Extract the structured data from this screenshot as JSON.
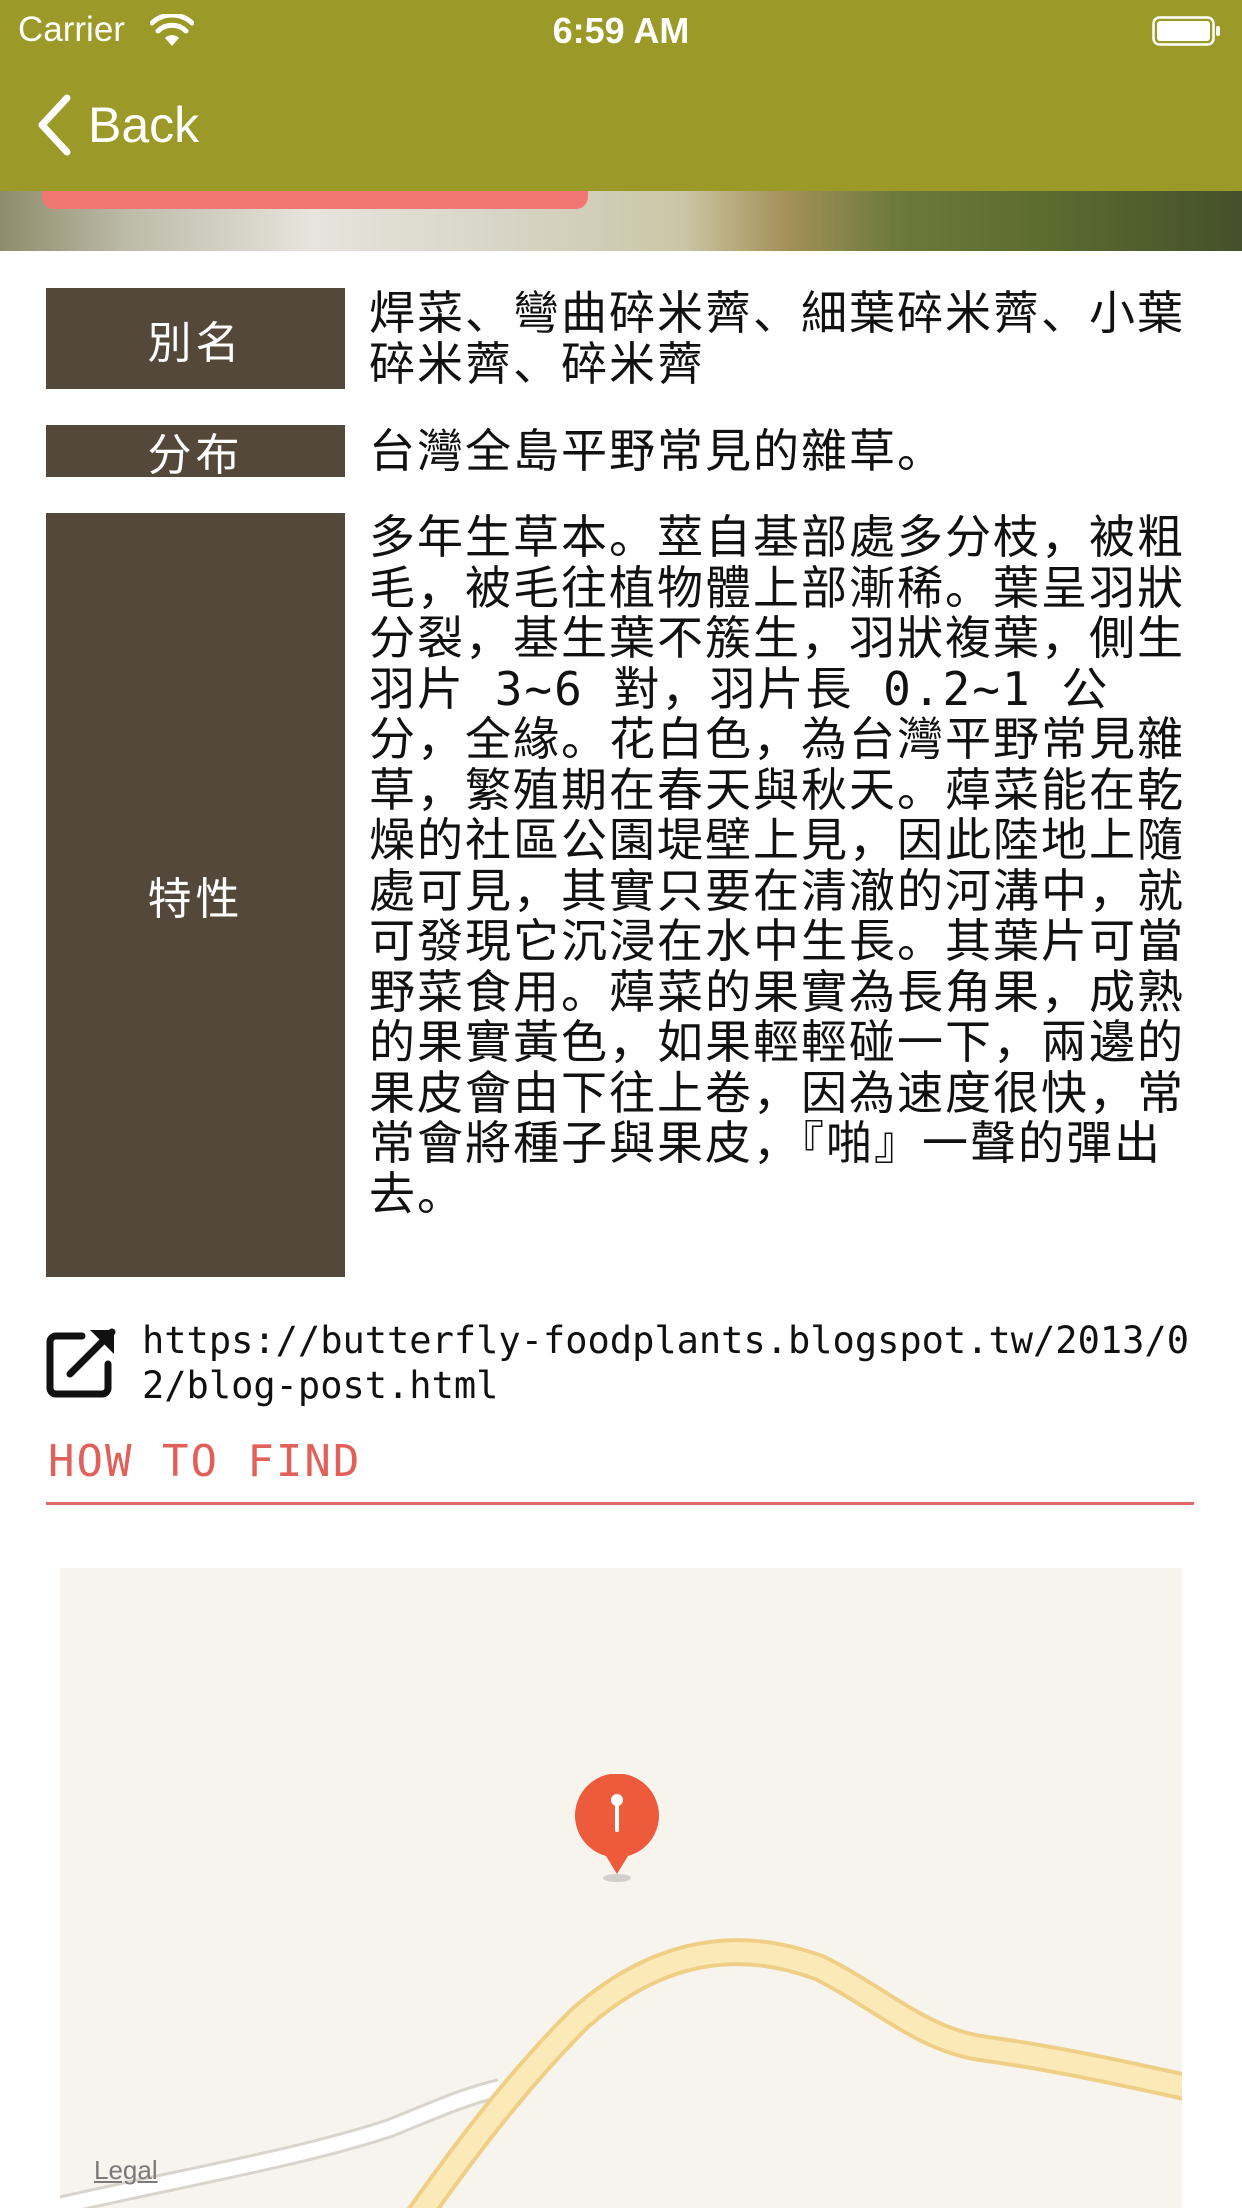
{
  "status_bar": {
    "carrier": "Carrier",
    "time": "6:59 AM"
  },
  "nav": {
    "back_label": "Back",
    "bar_color": "#9b9a28"
  },
  "info": [
    {
      "label": "別名",
      "value": "焊菜、彎曲碎米薺、細葉碎米薺、小葉碎米薺、碎米薺"
    },
    {
      "label": "分布",
      "value": "台灣全島平野常見的雜草。"
    },
    {
      "label": "特性",
      "value": "多年生草本。莖自基部處多分枝，被粗毛，被毛往植物體上部漸稀。葉呈羽狀分裂，基生葉不簇生，羽狀複葉，側生羽片 3~6 對，羽片長 0.2~1 公分，全緣。花白色，為台灣平野常見雜草，繁殖期在春天與秋天。蔊菜能在乾燥的社區公園堤壁上見，因此陸地上隨處可見，其實只要在清澈的河溝中，就可發現它沉浸在水中生長。其葉片可當野菜食用。蔊菜的果實為長角果，成熟的果實黃色，如果輕輕碰一下，兩邊的果皮會由下往上卷，因為速度很快，常常會將種子與果皮，『啪』一聲的彈出去。"
    }
  ],
  "source_link": {
    "url": "https://butterfly-foodplants.blogspot.tw/2013/02/blog-post.html",
    "icon": "external-link-icon"
  },
  "how_to_find": {
    "title": "HOW TO FIND"
  },
  "map": {
    "legal_label": "Legal",
    "pin_icon": "map-pin-icon",
    "pin_color": "#ee5a3c"
  },
  "colors": {
    "label_bg": "#54483a",
    "accent": "#e0605a",
    "hero_button": "#f07774"
  }
}
